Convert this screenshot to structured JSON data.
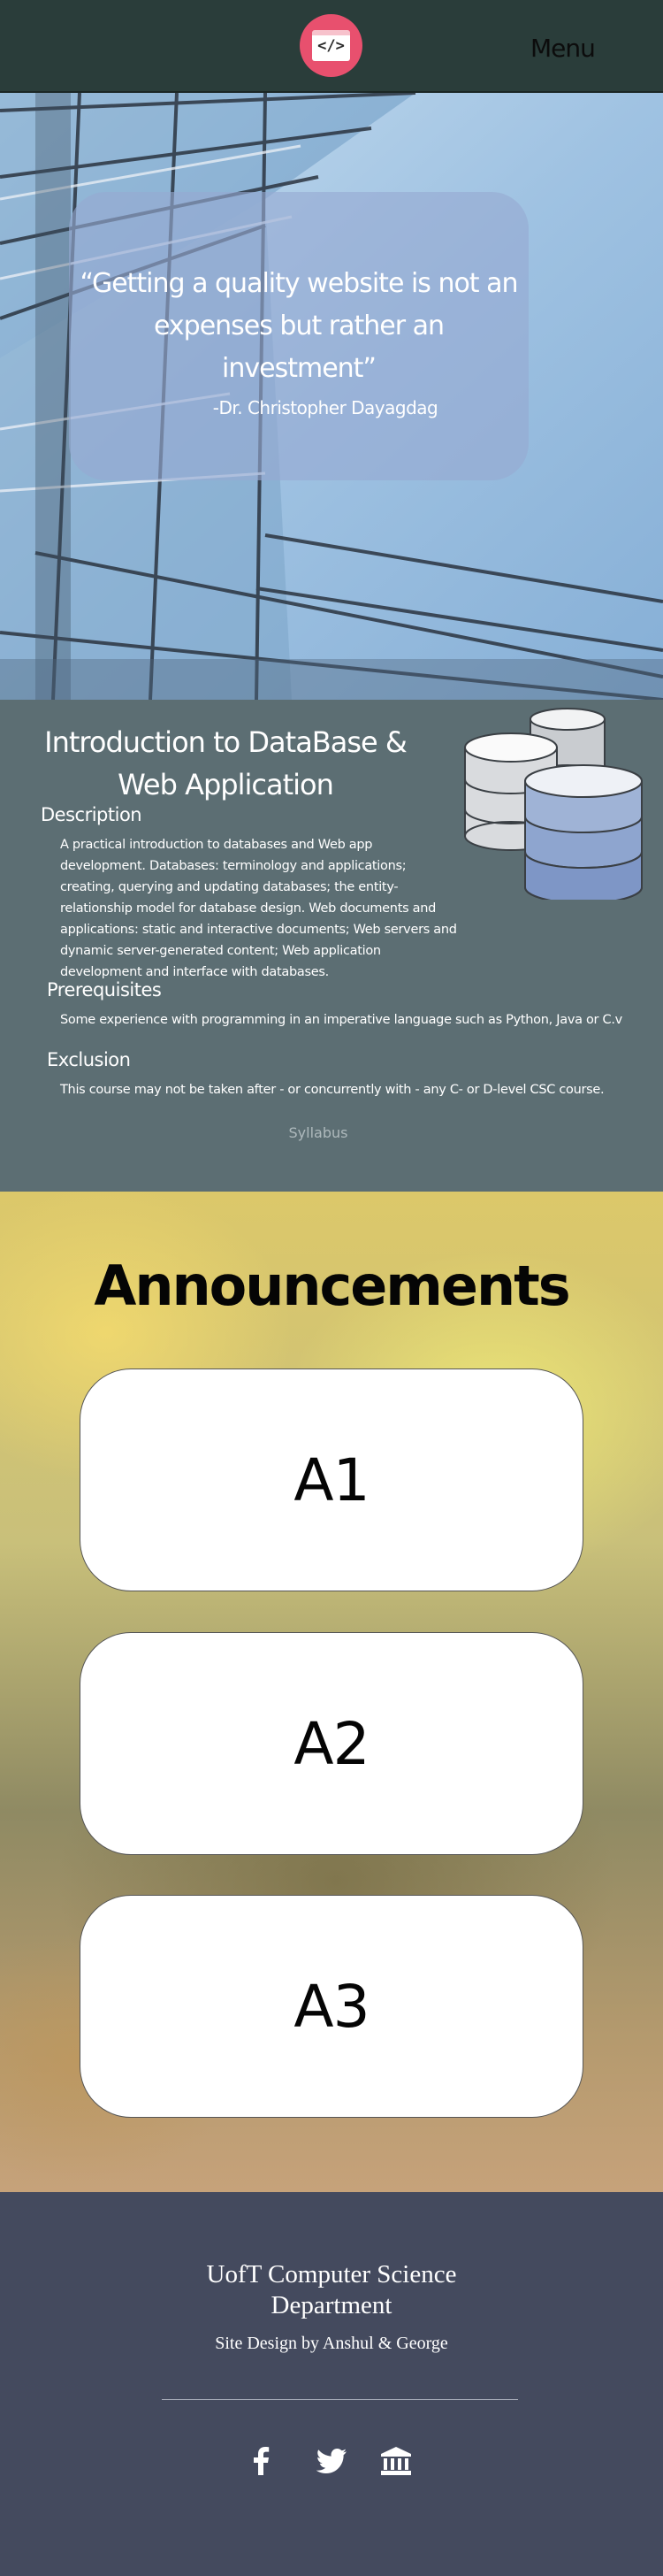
{
  "header": {
    "logo_code": "</>",
    "menu_label": "Menu"
  },
  "hero": {
    "quote": "“Getting a quality website is not an expenses but rather an investment”",
    "author": "-Dr. Christopher Dayagdag"
  },
  "course": {
    "title": "Introduction to DataBase & Web Application",
    "description_heading": "Description",
    "description_text": "A practical introduction to databases and Web app development. Databases: terminology and applications; creating, querying and updating databases; the entity-relationship model for database design. Web documents and applications: static and interactive documents; Web servers and dynamic server-generated content; Web application development and interface with databases.",
    "prerequisites_heading": "Prerequisites",
    "prerequisites_text": "Some experience with programming in an imperative language such as Python, Java or C.v",
    "exclusion_heading": "Exclusion",
    "exclusion_text": "This course may not be taken after - or concurrently with - any C- or D-level CSC course.",
    "syllabus_link": "Syllabus"
  },
  "announcements": {
    "title": "Announcements",
    "cards": [
      {
        "label": "A1"
      },
      {
        "label": "A2"
      },
      {
        "label": "A3"
      }
    ]
  },
  "footer": {
    "title": "UofT Computer Science Department",
    "credit": "Site Design by Anshul & George",
    "social": [
      {
        "icon": "facebook-icon"
      },
      {
        "icon": "twitter-icon"
      },
      {
        "icon": "institution-icon"
      }
    ]
  },
  "colors": {
    "header_bg": "#2a3d3a",
    "logo": "#e8506e",
    "course_bg": "#5c6e73",
    "footer_bg": "#444a5e"
  }
}
